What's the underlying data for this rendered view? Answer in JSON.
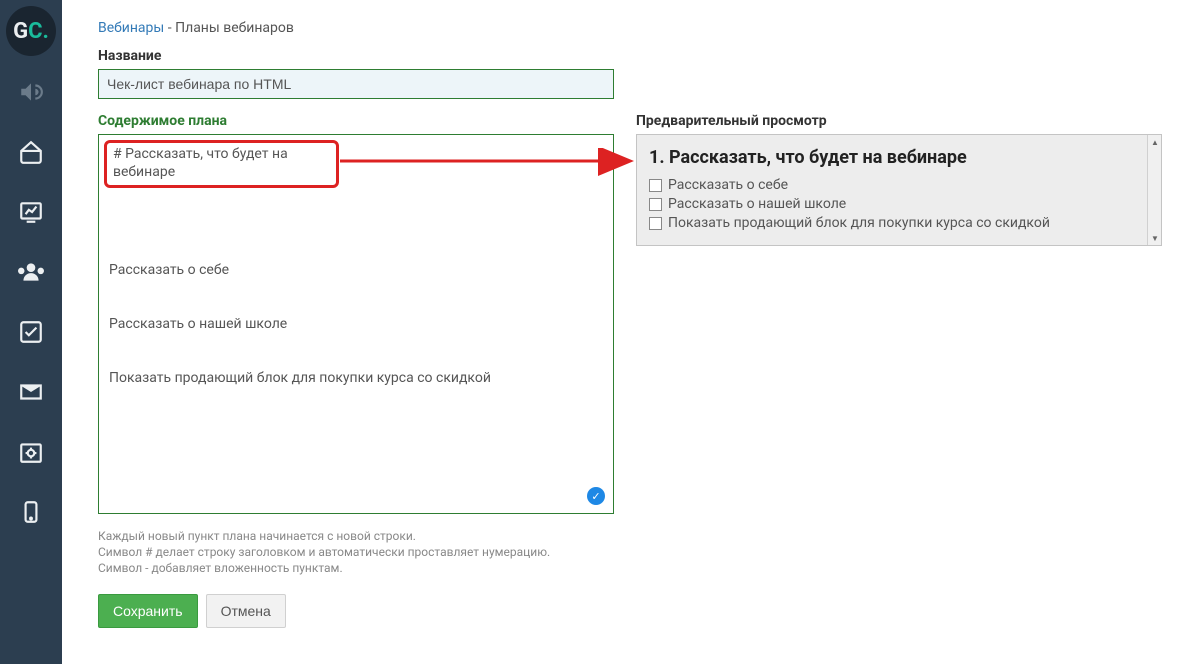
{
  "breadcrumb": {
    "link": "Вебинары",
    "separator": " - ",
    "current": "Планы вебинаров"
  },
  "labels": {
    "title": "Название",
    "content": "Содержимое плана",
    "preview": "Предварительный просмотр"
  },
  "inputs": {
    "title_value": "Чек-лист вебинара по HTML"
  },
  "plan_lines": {
    "line1": "# Рассказать, что будет на вебинаре",
    "line2": "Рассказать о себе",
    "line3": "Рассказать о нашей школе",
    "line4": "Показать продающий блок для покупки курса со скидкой"
  },
  "preview": {
    "heading": "1. Рассказать, что будет на вебинаре",
    "items": {
      "0": "Рассказать о себе",
      "1": "Рассказать о нашей школе",
      "2": "Показать продающий блок для покупки курса со скидкой"
    }
  },
  "help": {
    "l1": "Каждый новый пункт плана начинается с новой строки.",
    "l2": "Символ # делает строку заголовком и автоматически проставляет нумерацию.",
    "l3": "Символ - добавляет вложенность пунктам."
  },
  "buttons": {
    "save": "Сохранить",
    "cancel": "Отмена"
  }
}
